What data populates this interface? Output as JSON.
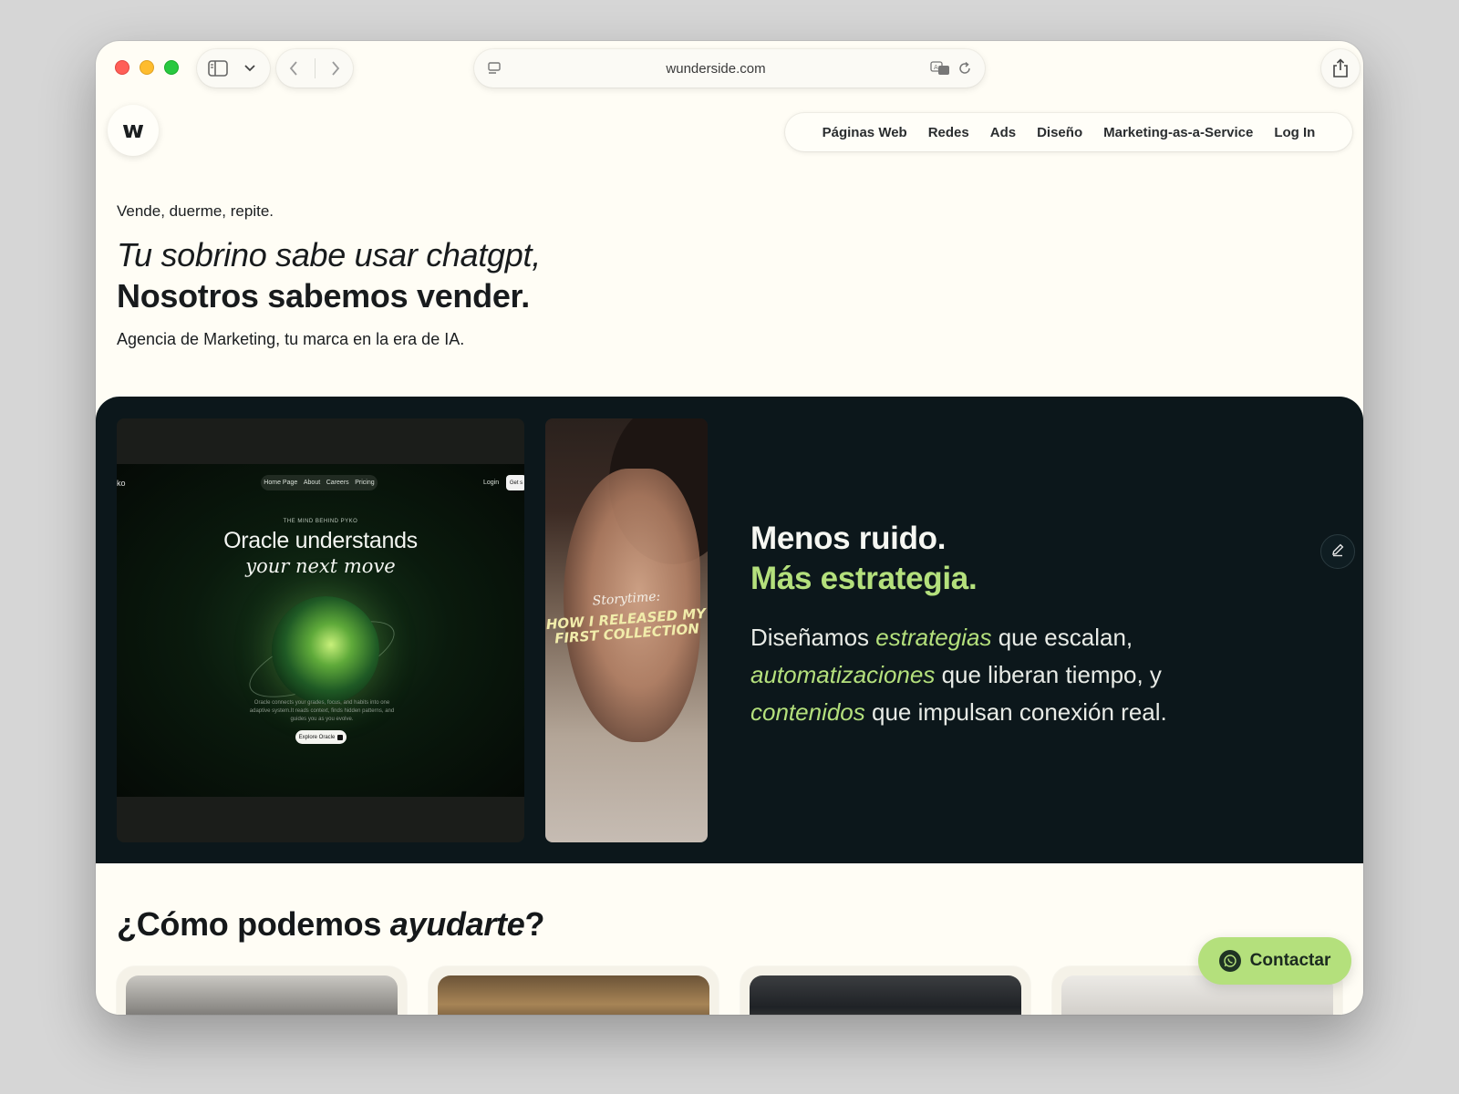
{
  "browser": {
    "url": "wunderside.com"
  },
  "site": {
    "logo_text": "w",
    "nav": [
      "Páginas Web",
      "Redes",
      "Ads",
      "Diseño",
      "Marketing-as-a-Service",
      "Log In"
    ]
  },
  "hero": {
    "tagline": "Vende, duerme, repite.",
    "headline_italic": "Tu sobrino sabe usar chatgpt,",
    "headline_bold": "Nosotros sabemos vender.",
    "subline": "Agencia de Marketing, tu marca en la era de IA."
  },
  "showcase": {
    "mockup": {
      "brand": "ko",
      "nav": [
        "Home Page",
        "About",
        "Careers",
        "Pricing"
      ],
      "login": "Login",
      "cta": "Get s",
      "kicker": "THE MIND BEHIND PYKO",
      "title": "Oracle understands",
      "subtitle": "your next move",
      "description": "Oracle connects your grades, focus, and habits into one adaptive system.It reads context, finds hidden patterns, and guides you as you evolve.",
      "button": "Explore Oracle"
    },
    "video": {
      "caption_script": "Storytime:",
      "caption_bold": "HOW I RELEASED MY FIRST COLLECTION"
    },
    "title_line1": "Menos ruido.",
    "title_line2": "Más estrategia.",
    "body": {
      "p1": "Diseñamos ",
      "e1": "estrategias",
      "p2": " que escalan, ",
      "e2": "automatizaciones",
      "p3": " que liberan tiempo, y ",
      "e3": "contenidos",
      "p4": " que impulsan conexión real."
    }
  },
  "help": {
    "title_plain": "¿Cómo podemos ",
    "title_italic": "ayudarte",
    "title_end": "?"
  },
  "contact": {
    "label": "Contactar"
  },
  "colors": {
    "accent_green": "#b4e07c",
    "dark_band": "#0c171b",
    "page_bg": "#fffdf5"
  }
}
